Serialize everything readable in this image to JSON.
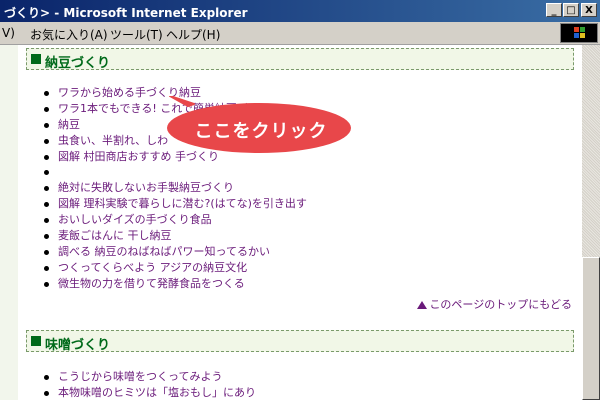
{
  "window": {
    "title": "づくり> - Microsoft Internet Explorer",
    "buttons": {
      "minimize": "_",
      "maximize": "□",
      "close": "X"
    }
  },
  "menubar": {
    "items": [
      "V)",
      "お気に入り(A)",
      "ツール(T)",
      "ヘルプ(H)"
    ]
  },
  "sections": [
    {
      "title": "納豆づくり",
      "links": [
        "ワラから始める手づくり納豆",
        "ワラ1本でもできる! これで簡単納豆づくり",
        "納豆",
        "虫食い、半割れ、しわ",
        "図解 村田商店おすすめ 手づくり",
        "",
        "絶対に失敗しないお手製納豆づくり",
        "図解 理科実験で暮らしに潜む?(はてな)を引き出す",
        "おいしいダイズの手づくり食品",
        "麦飯ごはんに 干し納豆",
        "調べる 納豆のねばねばパワー知ってるかい",
        "つくってくらべよう アジアの納豆文化",
        "微生物の力を借りて発酵食品をつくる"
      ]
    },
    {
      "title": "味噌づくり",
      "links": [
        "こうじから味噌をつくってみよう",
        "本物味噌のヒミツは「塩おもし」にあり"
      ]
    }
  ],
  "page_top_link": "このページのトップにもどる",
  "callout": {
    "text": "ここをクリック",
    "color": "#e8474a"
  },
  "colors": {
    "link": "#6a1a7a",
    "heading": "#006a1a",
    "heading_bg": "#f1f7e7"
  }
}
